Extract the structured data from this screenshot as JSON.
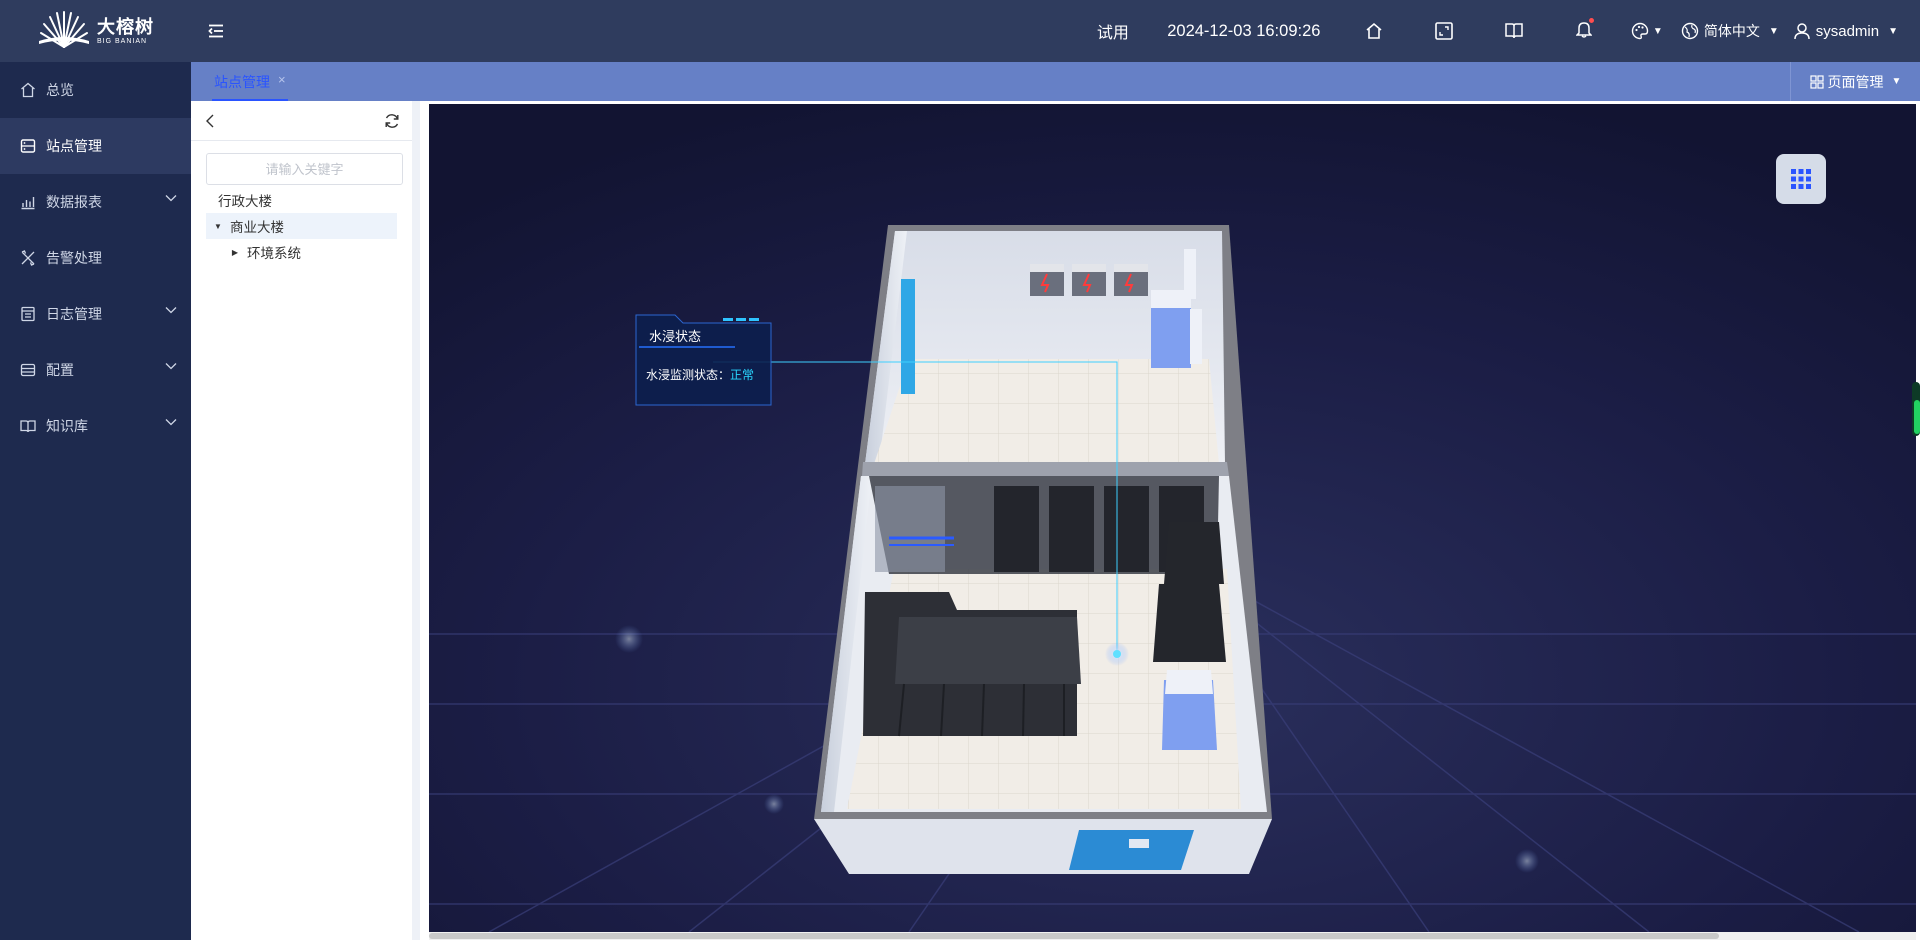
{
  "brand": {
    "name_cn": "大榕树",
    "name_en": "BIG BANIAN"
  },
  "header": {
    "trial_label": "试用",
    "datetime": "2024-12-03 16:09:26",
    "language": "简体中文",
    "username": "sysadmin",
    "icons": [
      "menu-fold-icon",
      "home-icon",
      "fullscreen-icon",
      "book-icon",
      "bell-icon",
      "palette-icon",
      "globe-icon",
      "user-icon"
    ]
  },
  "sidebar": {
    "items": [
      {
        "label": "总览",
        "icon": "home-icon",
        "expandable": false,
        "active": false
      },
      {
        "label": "站点管理",
        "icon": "server-icon",
        "expandable": false,
        "active": true
      },
      {
        "label": "数据报表",
        "icon": "bar-chart-icon",
        "expandable": true,
        "active": false
      },
      {
        "label": "告警处理",
        "icon": "tools-icon",
        "expandable": false,
        "active": false
      },
      {
        "label": "日志管理",
        "icon": "log-icon",
        "expandable": true,
        "active": false
      },
      {
        "label": "配置",
        "icon": "config-icon",
        "expandable": true,
        "active": false
      },
      {
        "label": "知识库",
        "icon": "book-icon",
        "expandable": true,
        "active": false
      }
    ]
  },
  "tabs": {
    "items": [
      {
        "label": "站点管理",
        "close": "×"
      }
    ],
    "page_manage_label": "页面管理"
  },
  "tree": {
    "search_placeholder": "请输入关键字",
    "nodes": [
      {
        "label": "行政大楼",
        "level": 0,
        "arrow": "",
        "selected": false
      },
      {
        "label": "商业大楼",
        "level": 0,
        "arrow": "▼",
        "selected": true
      },
      {
        "label": "环境系统",
        "level": 1,
        "arrow": "▶",
        "selected": false
      }
    ]
  },
  "sensor": {
    "title": "水浸状态",
    "status_label": "水浸监测状态：",
    "status_value": "正常"
  },
  "colors": {
    "topbar": "#2f3c5e",
    "sidebar": "#1e2a4e",
    "sidebar_active": "#2d3a61",
    "tabbar": "#6680c6",
    "accent": "#2a54ff",
    "sensor_value": "#29d7ff"
  }
}
